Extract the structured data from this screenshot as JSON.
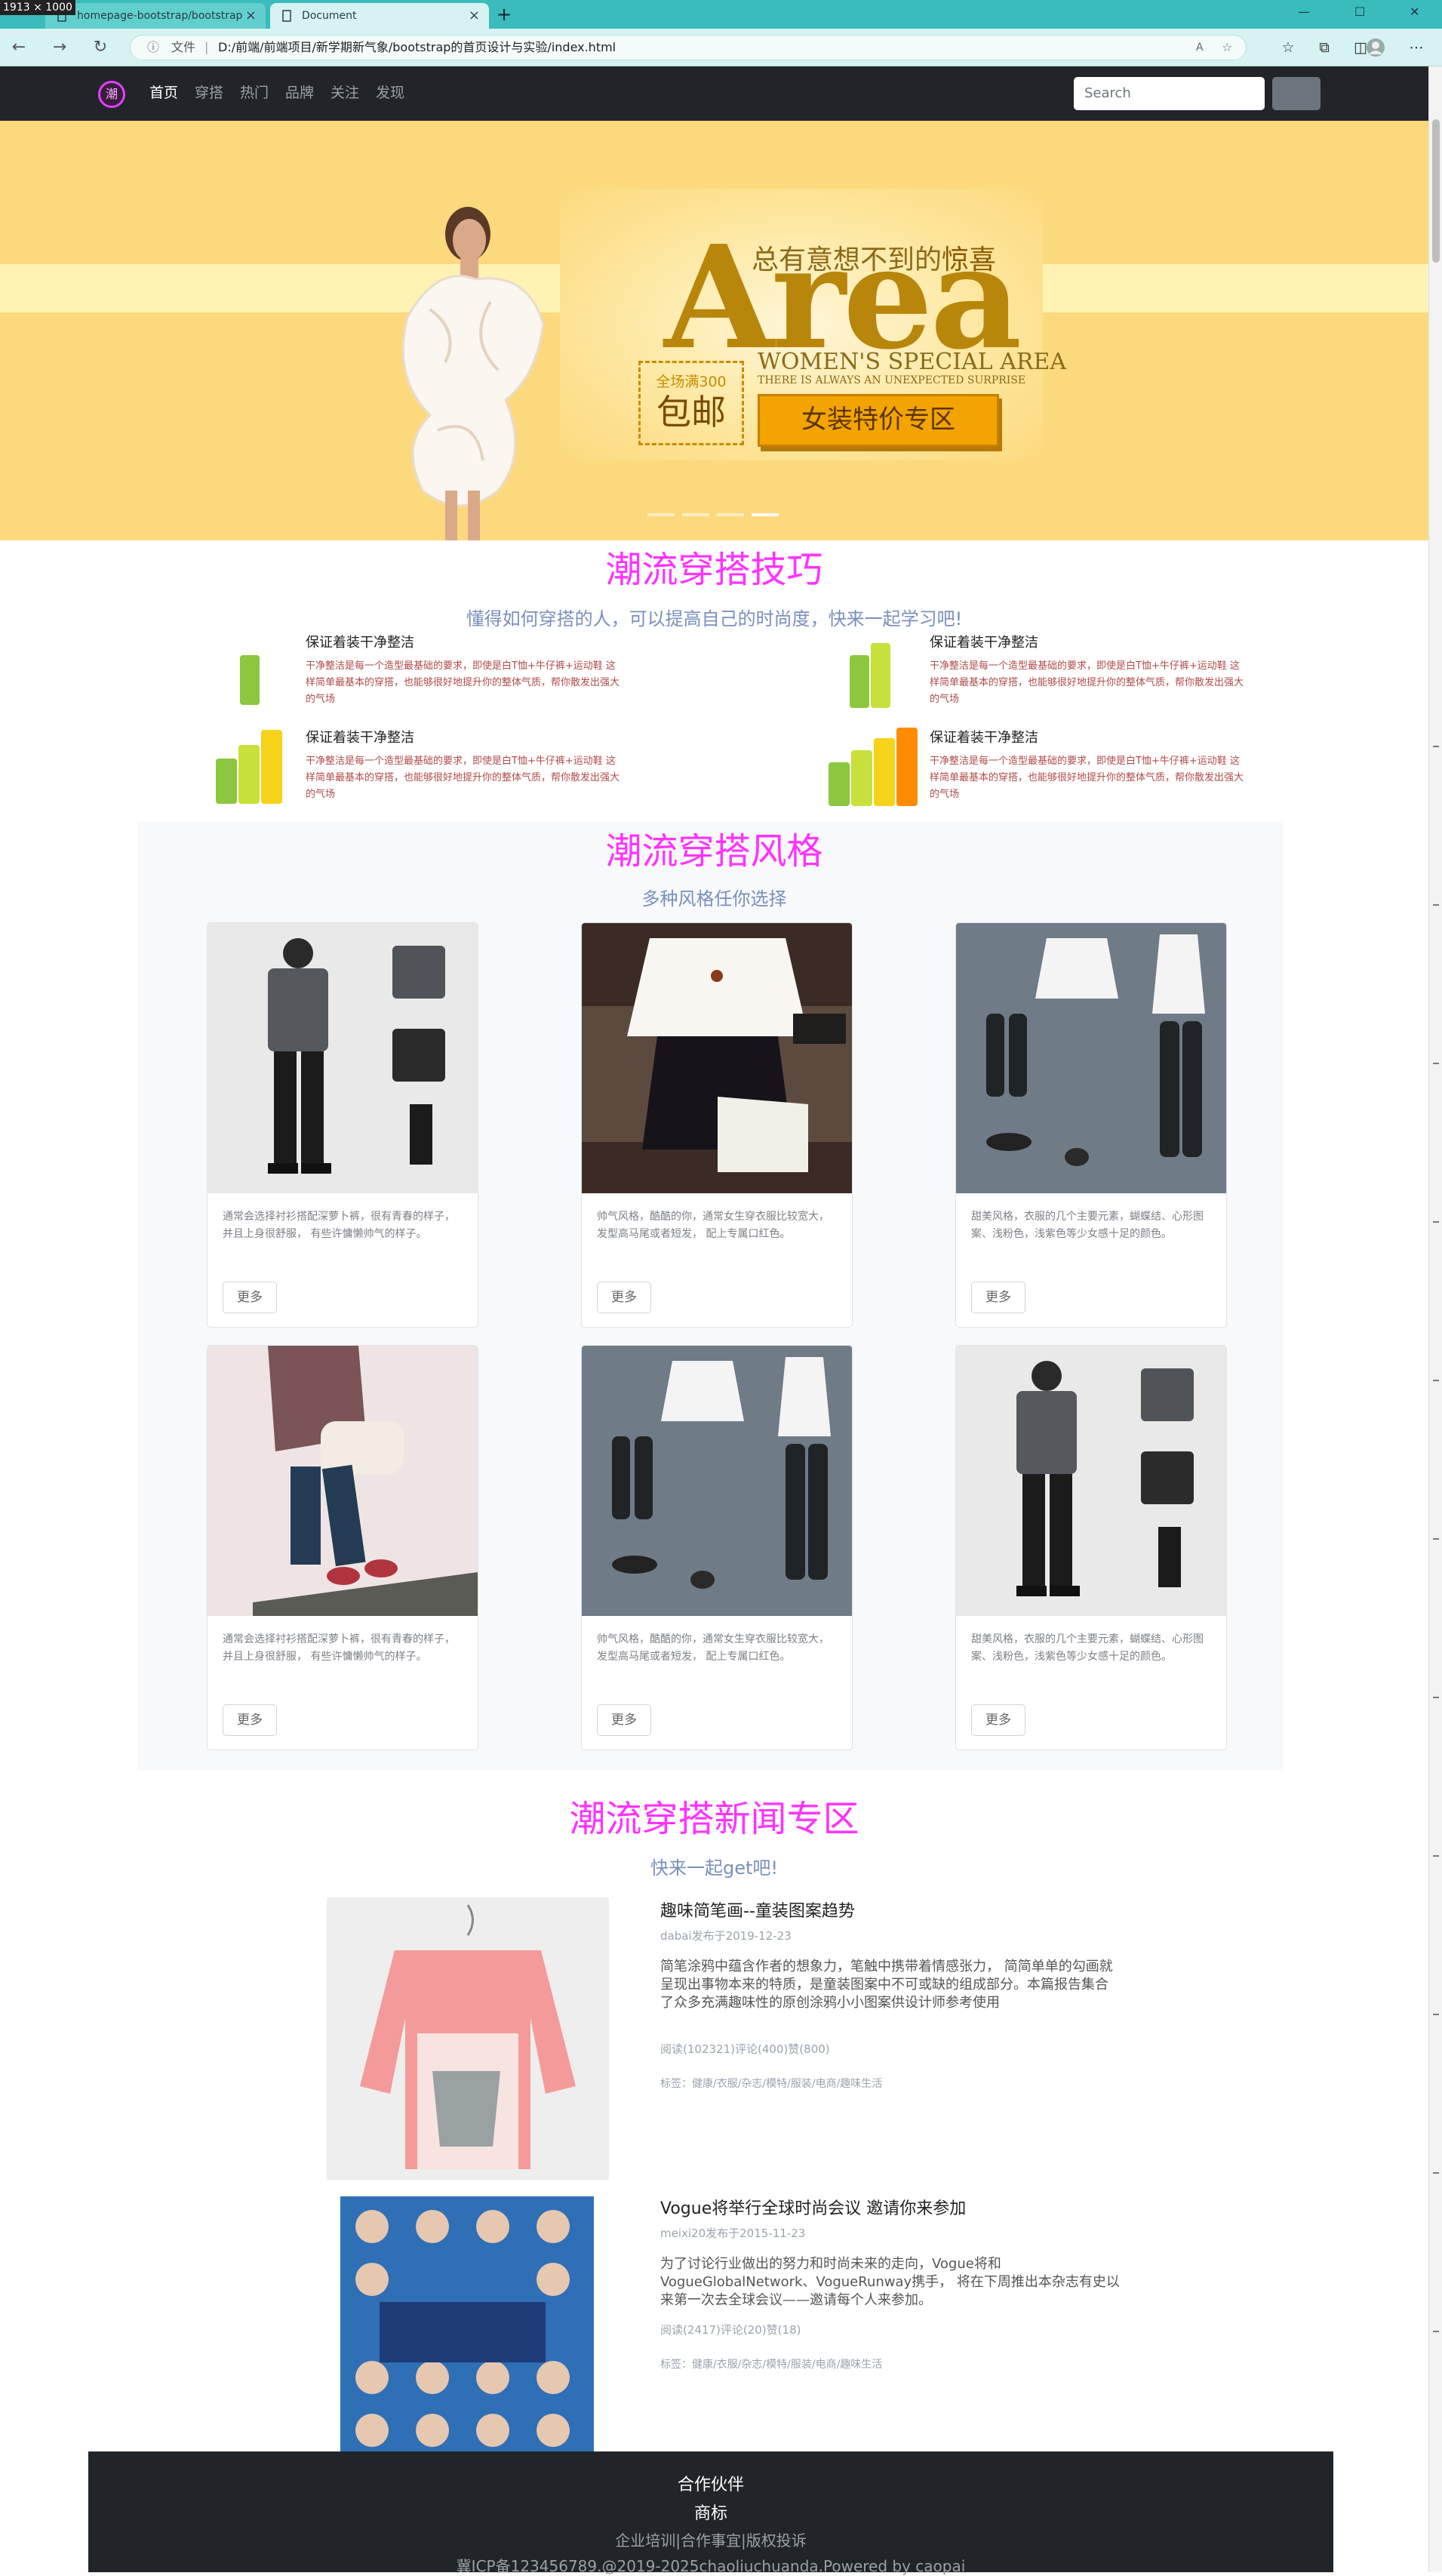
{
  "browser": {
    "dimension_label": "1913 × 1000",
    "tabs": [
      {
        "label": "homepage-bootstrap/bootstrap",
        "active": false
      },
      {
        "label": "Document",
        "active": true
      }
    ],
    "new_tab": "+",
    "address": {
      "prefix": "文件",
      "url": "D:/前端/前端项目/新学期新气象/bootstrap的首页设计与实验/index.html"
    },
    "window_controls": [
      "—",
      "☐",
      "✕"
    ]
  },
  "nav": {
    "logo_text": "潮",
    "links": [
      "首页",
      "穿搭",
      "热门",
      "品牌",
      "关注",
      "发现"
    ],
    "active_index": 0,
    "search_placeholder": "Search"
  },
  "banner": {
    "tagline_prefix": "总有意想不到的",
    "tagline_em": "惊喜",
    "headline": "Area",
    "sub1": "WOMEN'S SPECIAL AREA",
    "sub2": "THERE IS ALWAYS AN UNEXPECTED SURPRISE",
    "free_small": "全场满300",
    "free_big": "包邮",
    "cta": "女装特价专区",
    "slides": 4,
    "active_slide": 3
  },
  "tips_section": {
    "title": "潮流穿搭技巧",
    "subtitle": "懂得如何穿搭的人，可以提高自己的时尚度，快来一起学习吧!",
    "items": [
      {
        "heading": "保证着装干净整洁",
        "text": "干净整洁是每一个造型最基础的要求，即使是白T恤+牛仔裤+运动鞋 这样简单最基本的穿搭，也能够很好地提升你的整体气质，帮你散发出强大的气场"
      },
      {
        "heading": "保证着装干净整洁",
        "text": "干净整洁是每一个造型最基础的要求，即使是白T恤+牛仔裤+运动鞋 这样简单最基本的穿搭，也能够很好地提升你的整体气质，帮你散发出强大的气场"
      },
      {
        "heading": "保证着装干净整洁",
        "text": "干净整洁是每一个造型最基础的要求，即使是白T恤+牛仔裤+运动鞋 这样简单最基本的穿搭，也能够很好地提升你的整体气质，帮你散发出强大的气场"
      },
      {
        "heading": "保证着装干净整洁",
        "text": "干净整洁是每一个造型最基础的要求，即使是白T恤+牛仔裤+运动鞋 这样简单最基本的穿搭，也能够很好地提升你的整体气质，帮你散发出强大的气场"
      }
    ]
  },
  "style_section": {
    "title": "潮流穿搭风格",
    "subtitle": "多种风格任你选择",
    "more_label": "更多",
    "cards": [
      {
        "image": "menswear-gray-jacket",
        "text": "通常会选择衬衫搭配深萝卜裤，很有青春的样子，并且上身很舒服， 有些许慵懒帅气的样子。"
      },
      {
        "image": "white-blouse-black-skirt",
        "text": "帅气风格，酷酷的你，通常女生穿衣服比较宽大，发型高马尾或者短发， 配上专属口红色。"
      },
      {
        "image": "white-tee-cargo-pants",
        "text": "甜美风格，衣服的几个主要元素，蝴蝶结、心形图案、浅粉色，浅紫色等少女感十足的颜色。"
      },
      {
        "image": "plaid-shirt-bag",
        "text": "通常会选择衬衫搭配深萝卜裤，很有青春的样子，并且上身很舒服， 有些许慵懒帅气的样子。"
      },
      {
        "image": "white-tee-cargo-pants",
        "text": "帅气风格，酷酷的你，通常女生穿衣服比较宽大，发型高马尾或者短发， 配上专属口红色。"
      },
      {
        "image": "menswear-gray-jacket",
        "text": "甜美风格，衣服的几个主要元素，蝴蝶结、心形图案、浅粉色，浅紫色等少女感十足的颜色。"
      }
    ]
  },
  "news_section": {
    "title": "潮流穿搭新闻专区",
    "subtitle": "快来一起get吧!",
    "items": [
      {
        "image": "pink-kids-bib",
        "title": "趣味简笔画--童装图案趋势",
        "meta": "dabai发布于2019-12-23",
        "body": "简笔涂鸦中蕴含作者的想象力，笔触中携带着情感张力， 简简单单的勾画就呈现出事物本来的特质，是童装图案中不可或缺的组成部分。本篇报告集合了众多充满趣味性的原创涂鸦小小图案供设计师参考使用",
        "stats": "阅读(102321)评论(400)赞(800)",
        "tags": "标签：健康/衣服/杂志/模特/服装/电商/趣味生活"
      },
      {
        "image": "vogue-global-conversations",
        "title": "Vogue将举行全球时尚会议   邀请你来参加",
        "meta": "meixi20发布于2015-11-23",
        "body": "为了讨论行业做出的努力和时尚未来的走向，Vogue将和VogueGlobalNetwork、VogueRunway携手， 将在下周推出本杂志有史以来第一次去全球会议——邀请每个人来参加。",
        "stats": "阅读(2417)评论(20)赞(18)",
        "tags": "标签：健康/衣服/杂志/模特/服装/电商/趣味生活"
      }
    ]
  },
  "footer": {
    "line1": "合作伙伴",
    "line2": "商标",
    "line3": "企业培训|合作事宜|版权投诉",
    "line4": "冀ICP备123456789.@2019-2025chaoliuchuanda.Powered   by    caopai"
  },
  "colors": {
    "accent": "#ff33ff",
    "navbar": "#212529",
    "banner": "#fdd97d",
    "tab_bar": "#3bbcbc"
  }
}
